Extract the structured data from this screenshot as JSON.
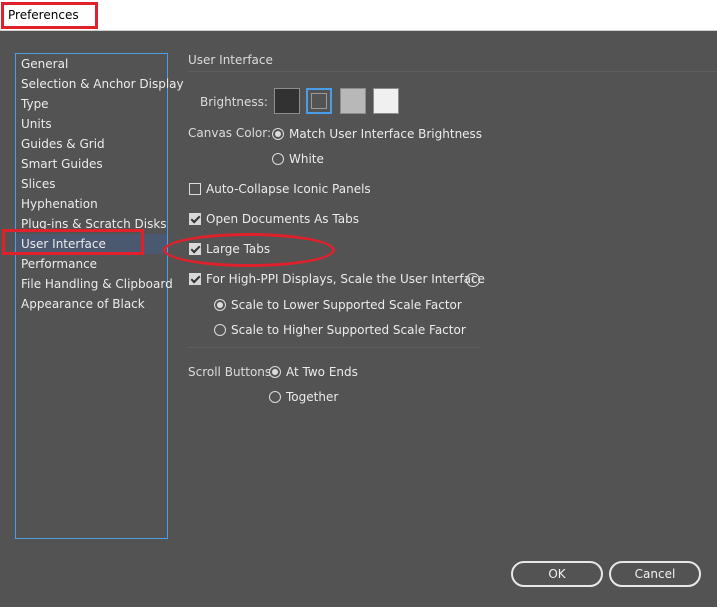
{
  "window": {
    "title": "Preferences"
  },
  "sidebar": {
    "items": [
      {
        "label": "General"
      },
      {
        "label": "Selection & Anchor Display"
      },
      {
        "label": "Type"
      },
      {
        "label": "Units"
      },
      {
        "label": "Guides & Grid"
      },
      {
        "label": "Smart Guides"
      },
      {
        "label": "Slices"
      },
      {
        "label": "Hyphenation"
      },
      {
        "label": "Plug-ins & Scratch Disks"
      },
      {
        "label": "User Interface"
      },
      {
        "label": "Performance"
      },
      {
        "label": "File Handling & Clipboard"
      },
      {
        "label": "Appearance of Black"
      }
    ],
    "selected": "User Interface"
  },
  "panel": {
    "section_title": "User Interface",
    "brightness": {
      "label": "Brightness:",
      "swatches": [
        "#323232",
        "#535353",
        "#b8b8b8",
        "#f0f0f0"
      ],
      "selected_index": 1
    },
    "canvas_color": {
      "label": "Canvas Color:",
      "options": [
        "Match User Interface Brightness",
        "White"
      ],
      "selected": "Match User Interface Brightness"
    },
    "checkboxes": {
      "auto_collapse": {
        "label": "Auto-Collapse Iconic Panels",
        "checked": false
      },
      "open_docs_tabs": {
        "label": "Open Documents As Tabs",
        "checked": true
      },
      "large_tabs": {
        "label": "Large Tabs",
        "checked": true
      },
      "high_ppi": {
        "label": "For High-PPI Displays, Scale the User Interface",
        "checked": true
      }
    },
    "scale_factor": {
      "options": [
        "Scale to Lower Supported Scale Factor",
        "Scale to Higher Supported Scale Factor"
      ],
      "selected": "Scale to Lower Supported Scale Factor"
    },
    "scroll_buttons": {
      "label": "Scroll Buttons:",
      "options": [
        "At Two Ends",
        "Together"
      ],
      "selected": "At Two Ends"
    }
  },
  "buttons": {
    "ok": "OK",
    "cancel": "Cancel"
  },
  "colors": {
    "background": "#535353",
    "accent": "#4a9ee8",
    "selection": "#4a5870",
    "annotation": "#e0202a"
  }
}
